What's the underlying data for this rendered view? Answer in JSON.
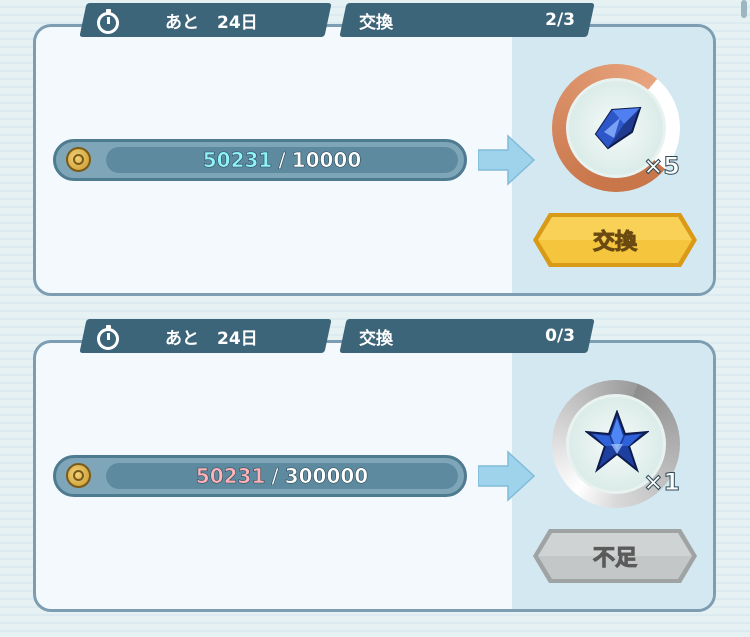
{
  "offers": [
    {
      "timer_prefix": "あと",
      "timer_value": "24日",
      "exchange_label": "交換",
      "exchange_count": "2/3",
      "owned": "50231",
      "separator": "/",
      "required": "10000",
      "reward_qty": "×5",
      "button_label": "交換",
      "reward_icon": "blue-crystal-shard-icon"
    },
    {
      "timer_prefix": "あと",
      "timer_value": "24日",
      "exchange_label": "交換",
      "exchange_count": "0/3",
      "owned": "50231",
      "separator": "/",
      "required": "300000",
      "reward_qty": "×1",
      "button_label": "不足",
      "reward_icon": "blue-star-crystal-icon"
    }
  ],
  "colors": {
    "tab_bg": "#3d6579",
    "card_border": "#7d9eb2",
    "owned_sufficient": "#8ff3f7",
    "owned_insufficient": "#ffb3b8",
    "button_active": "#f2c23a",
    "button_disabled": "#b9bdbd"
  }
}
